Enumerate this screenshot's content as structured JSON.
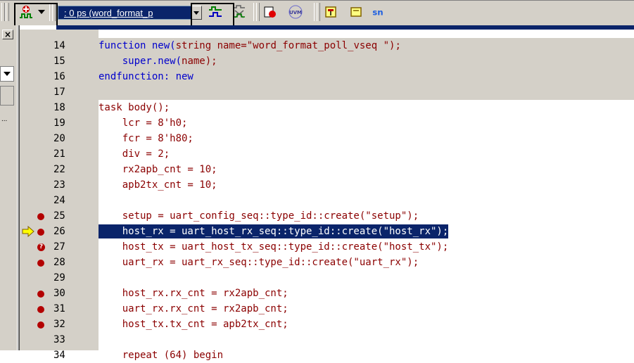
{
  "toolbar": {
    "time_combo_value": ": 0 ps (word_format_p",
    "icons": [
      "waveform-add-icon",
      "dropdown-arrow-icon",
      "signal-icon",
      "signal-compare-icon",
      "stop-icon",
      "uvm-icon",
      "bookmark-icon",
      "bookmark-outline-icon",
      "sn-icon"
    ],
    "sn_label": "sn",
    "uvm_label": "UVM"
  },
  "side_panel": {
    "close_label": "×",
    "ellipsis": "..."
  },
  "editor": {
    "lines": [
      {
        "num": "14",
        "bp": "",
        "bg": "grey",
        "segments": [
          {
            "t": "function new(",
            "c": "kw"
          },
          {
            "t": "string name=\"word_format_poll_vseq \");",
            "c": "def"
          }
        ]
      },
      {
        "num": "15",
        "bp": "",
        "bg": "grey",
        "segments": [
          {
            "t": "    ",
            "c": "def"
          },
          {
            "t": "super.new(",
            "c": "kw"
          },
          {
            "t": "name);",
            "c": "def"
          }
        ]
      },
      {
        "num": "16",
        "bp": "",
        "bg": "grey",
        "segments": [
          {
            "t": "endfunction: new",
            "c": "kw"
          }
        ]
      },
      {
        "num": "17",
        "bp": "",
        "bg": "grey",
        "segments": [
          {
            "t": "",
            "c": "def"
          }
        ]
      },
      {
        "num": "18",
        "bp": "",
        "bg": "white",
        "segments": [
          {
            "t": "task body();",
            "c": "def"
          }
        ]
      },
      {
        "num": "19",
        "bp": "",
        "bg": "white",
        "segments": [
          {
            "t": "    lcr = 8'h0;",
            "c": "def"
          }
        ]
      },
      {
        "num": "20",
        "bp": "",
        "bg": "white",
        "segments": [
          {
            "t": "    fcr = 8'h80;",
            "c": "def"
          }
        ]
      },
      {
        "num": "21",
        "bp": "",
        "bg": "white",
        "segments": [
          {
            "t": "    div = 2;",
            "c": "def"
          }
        ]
      },
      {
        "num": "22",
        "bp": "",
        "bg": "white",
        "segments": [
          {
            "t": "    rx2apb_cnt = 10;",
            "c": "def"
          }
        ]
      },
      {
        "num": "23",
        "bp": "",
        "bg": "white",
        "segments": [
          {
            "t": "    apb2tx_cnt = 10;",
            "c": "def"
          }
        ]
      },
      {
        "num": "24",
        "bp": "",
        "bg": "white",
        "segments": [
          {
            "t": "",
            "c": "def"
          }
        ]
      },
      {
        "num": "25",
        "bp": "dot",
        "bg": "white",
        "segments": [
          {
            "t": "    setup = uart_config_seq::type_id::create(\"setup\");",
            "c": "def"
          }
        ]
      },
      {
        "num": "26",
        "bp": "arrow",
        "bg": "highlight",
        "segments": [
          {
            "t": "    host_rx = uart_host_rx_seq::type_id::create(\"host_rx\");",
            "c": "def"
          }
        ]
      },
      {
        "num": "27",
        "bp": "question",
        "bg": "white",
        "segments": [
          {
            "t": "    host_tx = uart_host_tx_seq::type_id::create(\"host_tx\");",
            "c": "def"
          }
        ]
      },
      {
        "num": "28",
        "bp": "dot",
        "bg": "white",
        "segments": [
          {
            "t": "    uart_rx = uart_rx_seq::type_id::create(\"uart_rx\");",
            "c": "def"
          }
        ]
      },
      {
        "num": "29",
        "bp": "",
        "bg": "white",
        "segments": [
          {
            "t": "",
            "c": "def"
          }
        ]
      },
      {
        "num": "30",
        "bp": "dot",
        "bg": "white",
        "segments": [
          {
            "t": "    host_rx.rx_cnt = rx2apb_cnt;",
            "c": "def"
          }
        ]
      },
      {
        "num": "31",
        "bp": "dot",
        "bg": "white",
        "segments": [
          {
            "t": "    uart_rx.rx_cnt = rx2apb_cnt;",
            "c": "def"
          }
        ]
      },
      {
        "num": "32",
        "bp": "dot",
        "bg": "white",
        "segments": [
          {
            "t": "    host_tx.tx_cnt = apb2tx_cnt;",
            "c": "def"
          }
        ]
      },
      {
        "num": "33",
        "bp": "",
        "bg": "white",
        "segments": [
          {
            "t": "",
            "c": "def"
          }
        ]
      },
      {
        "num": "34",
        "bp": "",
        "bg": "white",
        "segments": [
          {
            "t": "    repeat (64) begin",
            "c": "def"
          }
        ]
      }
    ]
  },
  "colors": {
    "keyword": "#0000cc",
    "default_code": "#8b0000",
    "highlight_bg": "#0a246a",
    "breakpoint": "#b30000",
    "current_arrow": "#ffff00"
  }
}
